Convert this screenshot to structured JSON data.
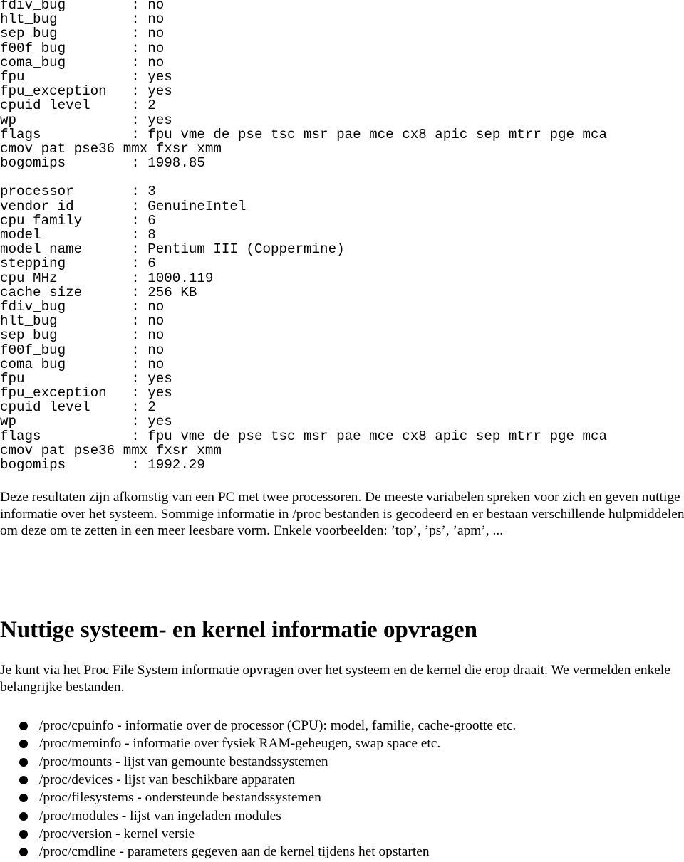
{
  "code_lines": [
    "fdiv_bug        : no",
    "hlt_bug         : no",
    "sep_bug         : no",
    "f00f_bug        : no",
    "coma_bug        : no",
    "fpu             : yes",
    "fpu_exception   : yes",
    "cpuid level     : 2",
    "wp              : yes",
    "flags           : fpu vme de pse tsc msr pae mce cx8 apic sep mtrr pge mca",
    "cmov pat pse36 mmx fxsr xmm",
    "bogomips        : 1998.85",
    "",
    "processor       : 3",
    "vendor_id       : GenuineIntel",
    "cpu family      : 6",
    "model           : 8",
    "model name      : Pentium III (Coppermine)",
    "stepping        : 6",
    "cpu MHz         : 1000.119",
    "cache size      : 256 KB",
    "fdiv_bug        : no",
    "hlt_bug         : no",
    "sep_bug         : no",
    "f00f_bug        : no",
    "coma_bug        : no",
    "fpu             : yes",
    "fpu_exception   : yes",
    "cpuid level     : 2",
    "wp              : yes",
    "flags           : fpu vme de pse tsc msr pae mce cx8 apic sep mtrr pge mca",
    "cmov pat pse36 mmx fxsr xmm",
    "bogomips        : 1992.29"
  ],
  "paragraph1": "Deze resultaten zijn afkomstig van een PC met twee processoren. De meeste variabelen spreken voor zich en geven nuttige informatie over het systeem. Sommige informatie in /proc bestanden is gecodeerd en er bestaan verschillende hulpmiddelen om deze om te zetten in een meer leesbare vorm. Enkele voorbeelden: ’top’, ’ps’, ’apm’, ...",
  "heading": "Nuttige systeem- en kernel informatie opvragen",
  "paragraph2": "Je kunt via het Proc File System informatie opvragen over het systeem en de kernel die erop draait. We vermelden enkele belangrijke bestanden.",
  "bullets": [
    "/proc/cpuinfo - informatie over de processor (CPU): model, familie, cache-grootte etc.",
    "/proc/meminfo - informatie over fysiek RAM-geheugen, swap space etc.",
    "/proc/mounts - lijst van gemounte bestandssystemen",
    "/proc/devices - lijst van beschikbare apparaten",
    "/proc/filesystems - ondersteunde bestandssystemen",
    "/proc/modules - lijst van ingeladen modules",
    "/proc/version - kernel versie",
    "/proc/cmdline - parameters gegeven aan de kernel tijdens het opstarten"
  ]
}
